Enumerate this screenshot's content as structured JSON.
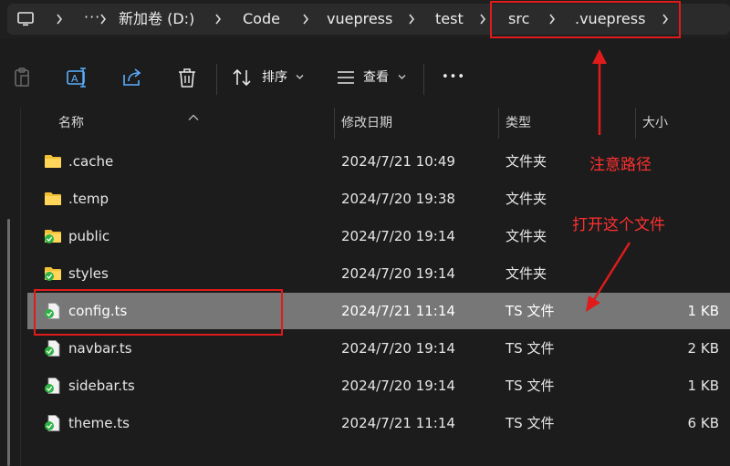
{
  "address_bar": {
    "more": "···",
    "crumbs": [
      "新加卷 (D:)",
      "Code",
      "vuepress",
      "test",
      "src",
      ".vuepress"
    ]
  },
  "toolbar": {
    "sort_label": "排序",
    "view_label": "查看",
    "more": "•••"
  },
  "columns": {
    "name": "名称",
    "modified": "修改日期",
    "type": "类型",
    "size": "大小"
  },
  "files": [
    {
      "name": ".cache",
      "modified": "2024/7/21 10:49",
      "type": "文件夹",
      "size": "",
      "icon": "folder-icon"
    },
    {
      "name": ".temp",
      "modified": "2024/7/20 19:38",
      "type": "文件夹",
      "size": "",
      "icon": "folder-icon"
    },
    {
      "name": "public",
      "modified": "2024/7/20 19:14",
      "type": "文件夹",
      "size": "",
      "icon": "synced-folder-icon"
    },
    {
      "name": "styles",
      "modified": "2024/7/20 19:14",
      "type": "文件夹",
      "size": "",
      "icon": "synced-folder-icon"
    },
    {
      "name": "config.ts",
      "modified": "2024/7/21 11:14",
      "type": "TS 文件",
      "size": "1 KB",
      "icon": "synced-file-icon",
      "selected": true
    },
    {
      "name": "navbar.ts",
      "modified": "2024/7/20 19:14",
      "type": "TS 文件",
      "size": "2 KB",
      "icon": "synced-file-icon"
    },
    {
      "name": "sidebar.ts",
      "modified": "2024/7/20 19:14",
      "type": "TS 文件",
      "size": "1 KB",
      "icon": "synced-file-icon"
    },
    {
      "name": "theme.ts",
      "modified": "2024/7/21 11:14",
      "type": "TS 文件",
      "size": "6 KB",
      "icon": "synced-file-icon"
    }
  ],
  "annotations": {
    "path_note": "注意路径",
    "open_note": "打开这个文件"
  },
  "colors": {
    "annotation_red": "#e01b1b",
    "folder_yellow": "#f2c037",
    "sync_green": "#2fb344",
    "selected_row": "#777777"
  }
}
